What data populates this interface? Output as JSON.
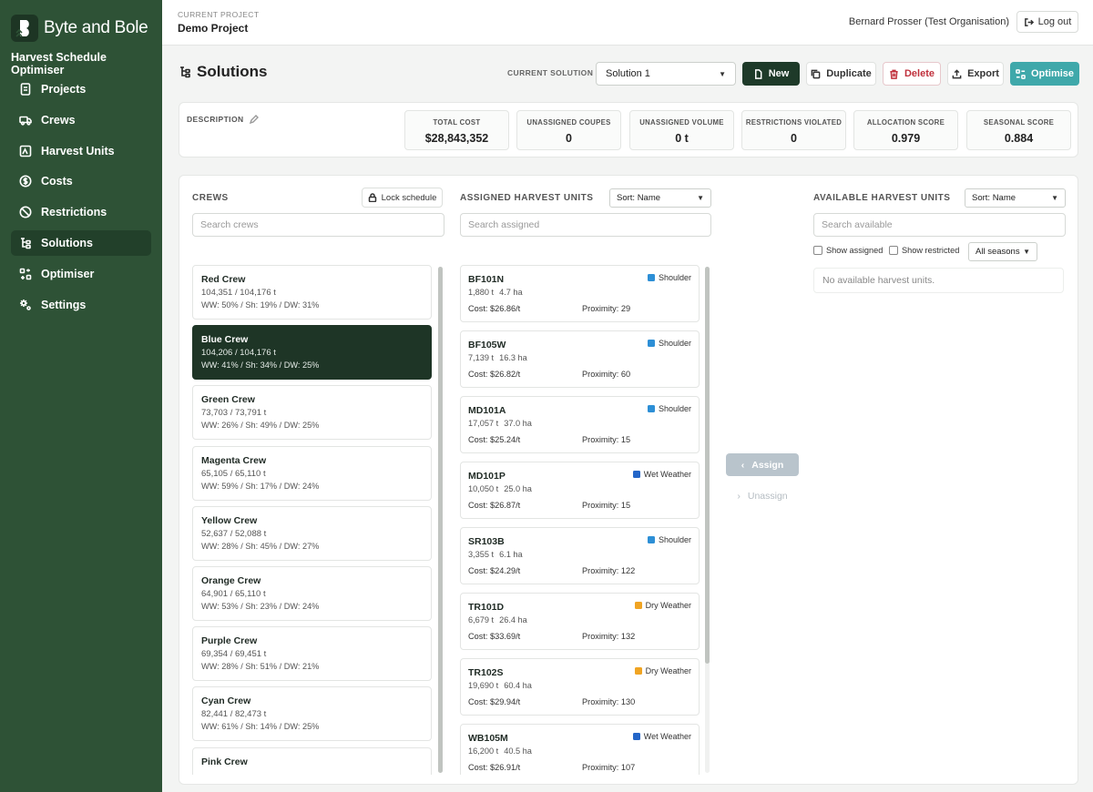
{
  "brand": {
    "name": "Byte and Bole",
    "app_title": "Harvest Schedule Optimiser"
  },
  "nav": [
    {
      "label": "Projects",
      "icon": "document-icon"
    },
    {
      "label": "Crews",
      "icon": "truck-icon"
    },
    {
      "label": "Harvest Units",
      "icon": "map-icon"
    },
    {
      "label": "Costs",
      "icon": "dollar-icon"
    },
    {
      "label": "Restrictions",
      "icon": "ban-icon"
    },
    {
      "label": "Solutions",
      "icon": "tree-icon",
      "active": true
    },
    {
      "label": "Optimiser",
      "icon": "optimise-icon"
    },
    {
      "label": "Settings",
      "icon": "gear-icon"
    }
  ],
  "topbar": {
    "project_label": "CURRENT PROJECT",
    "project_name": "Demo Project",
    "user": "Bernard Prosser (Test Organisation)",
    "logout": "Log out"
  },
  "header": {
    "title": "Solutions",
    "current_solution_label": "CURRENT SOLUTION",
    "current_solution": "Solution 1",
    "buttons": {
      "new": "New",
      "duplicate": "Duplicate",
      "delete": "Delete",
      "export": "Export",
      "optimise": "Optimise"
    }
  },
  "summary": {
    "description_label": "DESCRIPTION",
    "stats": [
      {
        "label": "TOTAL COST",
        "value": "$28,843,352"
      },
      {
        "label": "UNASSIGNED COUPES",
        "value": "0"
      },
      {
        "label": "UNASSIGNED VOLUME",
        "value": "0 t"
      },
      {
        "label": "RESTRICTIONS VIOLATED",
        "value": "0"
      },
      {
        "label": "ALLOCATION SCORE",
        "value": "0.979"
      },
      {
        "label": "SEASONAL SCORE",
        "value": "0.884"
      }
    ]
  },
  "crews": {
    "title": "CREWS",
    "lock": "Lock schedule",
    "search_placeholder": "Search crews",
    "items": [
      {
        "name": "Red Crew",
        "volume": "104,351 / 104,176 t",
        "mix": "WW: 50% / Sh: 19% / DW: 31%"
      },
      {
        "name": "Blue Crew",
        "volume": "104,206 / 104,176 t",
        "mix": "WW: 41% / Sh: 34% / DW: 25%",
        "selected": true
      },
      {
        "name": "Green Crew",
        "volume": "73,703 / 73,791 t",
        "mix": "WW: 26% / Sh: 49% / DW: 25%"
      },
      {
        "name": "Magenta Crew",
        "volume": "65,105 / 65,110 t",
        "mix": "WW: 59% / Sh: 17% / DW: 24%"
      },
      {
        "name": "Yellow Crew",
        "volume": "52,637 / 52,088 t",
        "mix": "WW: 28% / Sh: 45% / DW: 27%"
      },
      {
        "name": "Orange Crew",
        "volume": "64,901 / 65,110 t",
        "mix": "WW: 53% / Sh: 23% / DW: 24%"
      },
      {
        "name": "Purple Crew",
        "volume": "69,354 / 69,451 t",
        "mix": "WW: 28% / Sh: 51% / DW: 21%"
      },
      {
        "name": "Cyan Crew",
        "volume": "82,441 / 82,473 t",
        "mix": "WW: 61% / Sh: 14% / DW: 25%"
      },
      {
        "name": "Pink Crew",
        "volume": "",
        "mix": ""
      }
    ]
  },
  "assigned": {
    "title": "ASSIGNED HARVEST UNITS",
    "sort": "Sort: Name",
    "search_placeholder": "Search assigned",
    "units": [
      {
        "name": "BF101N",
        "tonnes": "1,880 t",
        "area": "4.7 ha",
        "cost": "Cost: $26.86/t",
        "proximity": "Proximity: 29",
        "season": "Shoulder",
        "season_color": "#2d8fd6"
      },
      {
        "name": "BF105W",
        "tonnes": "7,139 t",
        "area": "16.3 ha",
        "cost": "Cost: $26.82/t",
        "proximity": "Proximity: 60",
        "season": "Shoulder",
        "season_color": "#2d8fd6"
      },
      {
        "name": "MD101A",
        "tonnes": "17,057 t",
        "area": "37.0 ha",
        "cost": "Cost: $25.24/t",
        "proximity": "Proximity: 15",
        "season": "Shoulder",
        "season_color": "#2d8fd6"
      },
      {
        "name": "MD101P",
        "tonnes": "10,050 t",
        "area": "25.0 ha",
        "cost": "Cost: $26.87/t",
        "proximity": "Proximity: 15",
        "season": "Wet Weather",
        "season_color": "#2466c8"
      },
      {
        "name": "SR103B",
        "tonnes": "3,355 t",
        "area": "6.1 ha",
        "cost": "Cost: $24.29/t",
        "proximity": "Proximity: 122",
        "season": "Shoulder",
        "season_color": "#2d8fd6"
      },
      {
        "name": "TR101D",
        "tonnes": "6,679 t",
        "area": "26.4 ha",
        "cost": "Cost: $33.69/t",
        "proximity": "Proximity: 132",
        "season": "Dry Weather",
        "season_color": "#f0a423"
      },
      {
        "name": "TR102S",
        "tonnes": "19,690 t",
        "area": "60.4 ha",
        "cost": "Cost: $29.94/t",
        "proximity": "Proximity: 130",
        "season": "Dry Weather",
        "season_color": "#f0a423"
      },
      {
        "name": "WB105M",
        "tonnes": "16,200 t",
        "area": "40.5 ha",
        "cost": "Cost: $26.91/t",
        "proximity": "Proximity: 107",
        "season": "Wet Weather",
        "season_color": "#2466c8"
      }
    ]
  },
  "actions": {
    "assign": "Assign",
    "unassign": "Unassign"
  },
  "available": {
    "title": "AVAILABLE HARVEST UNITS",
    "sort": "Sort: Name",
    "search_placeholder": "Search available",
    "show_assigned": "Show assigned",
    "show_restricted": "Show restricted",
    "season_filter": "All seasons",
    "empty": "No available harvest units."
  }
}
